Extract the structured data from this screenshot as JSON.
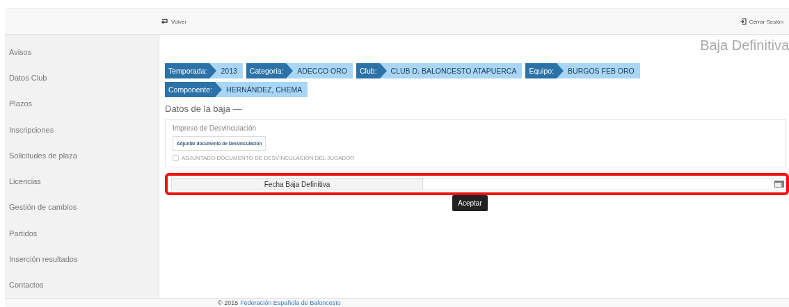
{
  "header": {
    "back_link": "Volver",
    "logout_link": "Cerrar Sesión"
  },
  "sidebar": {
    "items": [
      {
        "label": "Avisos",
        "selected": false
      },
      {
        "label": "Datos Club",
        "selected": false
      },
      {
        "label": "Plazos",
        "selected": false
      },
      {
        "label": "Inscripciones",
        "selected": false
      },
      {
        "label": "Solicitudes de plaza",
        "selected": false
      },
      {
        "label": "Licencias",
        "selected": false
      },
      {
        "label": "Gestión de cambios",
        "selected": false
      },
      {
        "label": "Partidos",
        "selected": false
      },
      {
        "label": "Inserción resultados",
        "selected": false
      },
      {
        "label": "Contactos",
        "selected": false
      }
    ]
  },
  "page_title": "Baja Definitiva",
  "breadcrumb_rows": [
    [
      {
        "key": "Temporada:",
        "value": "2013"
      },
      {
        "key": "Categoria:",
        "value": "ADECCO ORO"
      },
      {
        "key": "Club:",
        "value": "CLUB D. BALONCESTO ATAPUERCA"
      },
      {
        "key": "Equipo:",
        "value": "BURGOS FEB ORO"
      }
    ],
    [
      {
        "key": "Componente:",
        "value": "HERNÁNDEZ, CHEMA"
      }
    ]
  ],
  "section_title": "Datos de la baja —",
  "document_panel": {
    "title": "Impreso de Desvinculación",
    "upload_button": "Adjuntar documento de Desvinculación",
    "checkbox": {
      "label": "ADJUNTADO DOCUMENTO DE DESVINCULACION DEL JUGADOR",
      "checked": false
    }
  },
  "date_field": {
    "label": "Fecha Baja Definitiva",
    "highlighted": true
  },
  "submit_button": "Aceptar",
  "footer": {
    "prefix": "© 2015",
    "link": "Federación Española de Baloncesto"
  }
}
